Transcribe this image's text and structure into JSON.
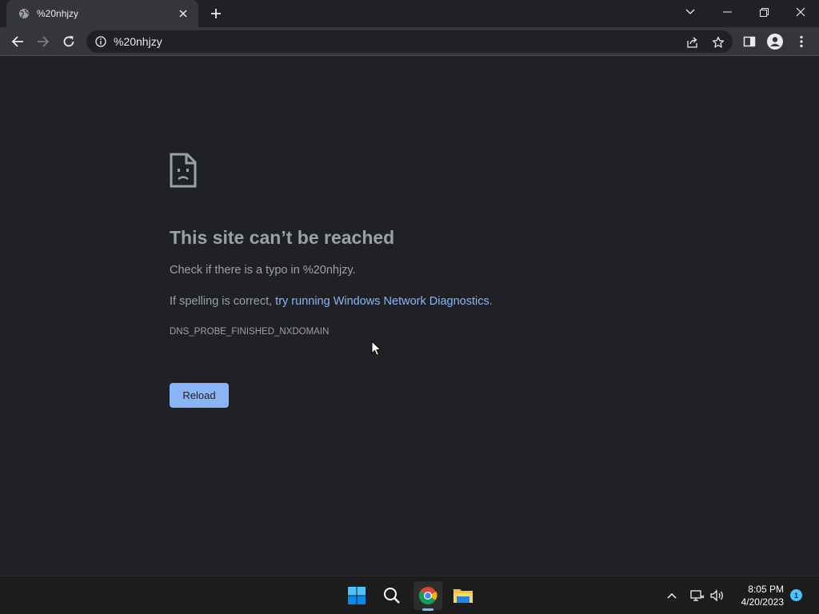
{
  "tab": {
    "title": "%20nhjzy",
    "favicon": "globe-icon"
  },
  "omnibox": {
    "url": "%20nhjzy"
  },
  "error": {
    "title": "This site can’t be reached",
    "line1": "Check if there is a typo in %20nhjzy.",
    "line2_prefix": "If spelling is correct, ",
    "line2_link": "try running Windows Network Diagnostics",
    "line2_suffix": ".",
    "code": "DNS_PROBE_FINISHED_NXDOMAIN",
    "reload_label": "Reload"
  },
  "taskbar": {
    "time": "8:05 PM",
    "date": "4/20/2023",
    "notification_count": "1",
    "apps": [
      "start-icon",
      "search-icon",
      "chrome-icon",
      "file-explorer-icon"
    ]
  },
  "colors": {
    "background": "#202124",
    "toolbar": "#35363a",
    "link": "#8ab4f8",
    "button": "#8ab4f8",
    "text_secondary": "#9aa0a6"
  }
}
